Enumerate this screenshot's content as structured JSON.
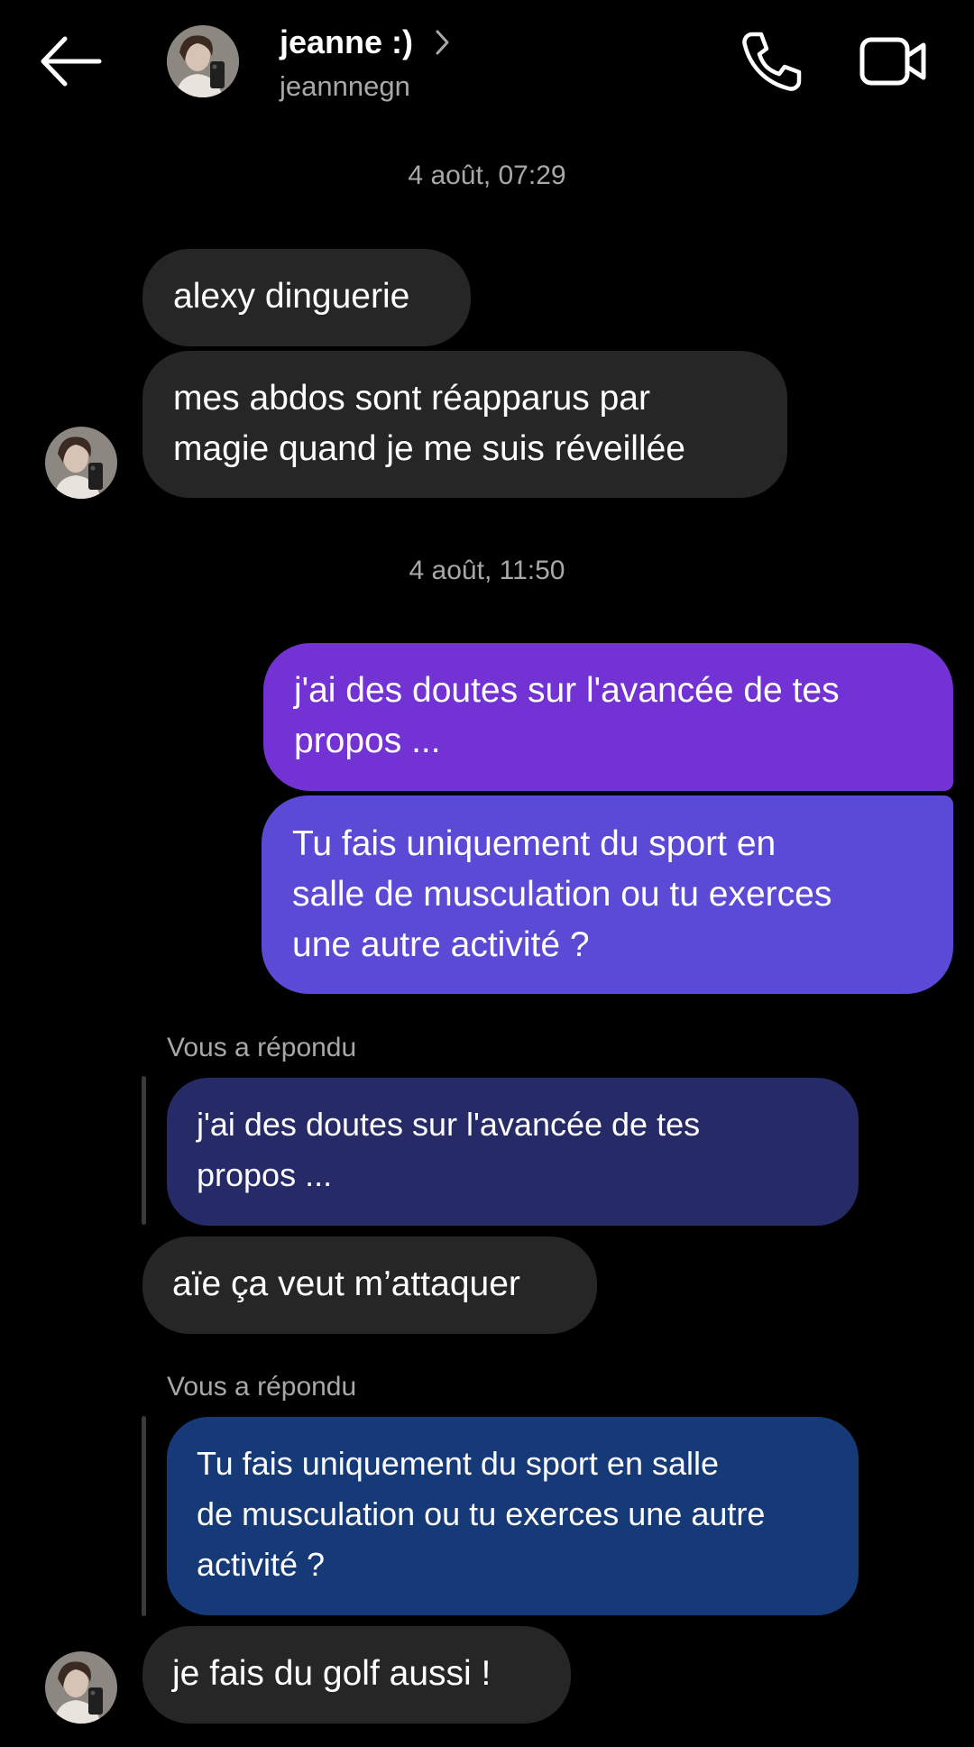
{
  "header": {
    "display_name": "jeanne :)",
    "username": "jeannnegn",
    "icons": {
      "back": "arrow-left-icon",
      "chevron": "chevron-right-icon",
      "call": "phone-icon",
      "video": "video-camera-icon"
    }
  },
  "timestamps": [
    "4 août, 07:29",
    "4 août, 11:50"
  ],
  "messages": {
    "m1": "alexy dinguerie",
    "m2": "mes abdos sont réapparus par\nmagie quand je me suis réveillée",
    "m3": "j'ai des doutes sur l'avancée de tes\npropos ...",
    "m4": "Tu fais uniquement du sport en\nsalle de musculation ou tu exerces\nune autre activité ?",
    "reply1_label": "Vous a répondu",
    "reply1_quote": "j'ai des doutes sur l'avancée de tes\npropos ...",
    "m5": "aïe ça veut m’attaquer",
    "reply2_label": "Vous a répondu",
    "reply2_quote": "Tu fais uniquement du sport en salle\nde musculation ou tu exerces une autre\nactivité ?",
    "m6": "je fais du golf aussi !"
  },
  "colors": {
    "background": "#000000",
    "incoming_bubble": "#262626",
    "outgoing_top": "#7232d4",
    "outgoing_bottom": "#5a4ad6",
    "reply_quote_1": "#262a66",
    "reply_quote_2": "#163a78",
    "secondary_text": "#a8a8a8"
  }
}
